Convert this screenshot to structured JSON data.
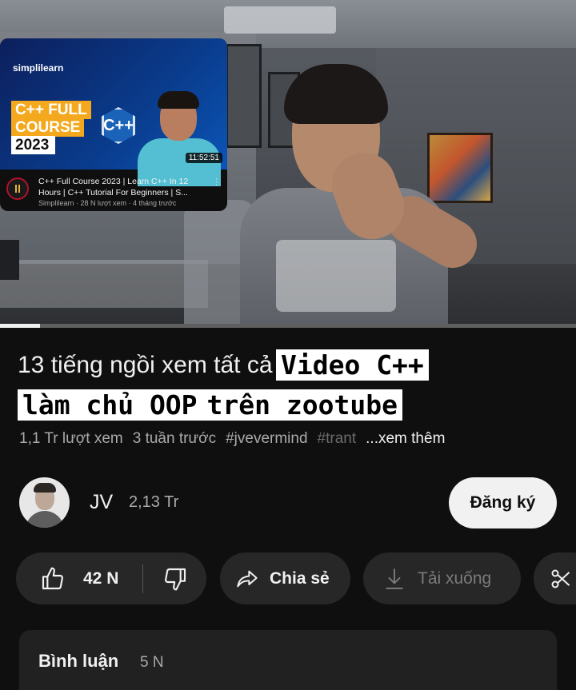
{
  "player": {
    "progress_fraction": 0.07,
    "embedded_card": {
      "brand": "simplilearn",
      "logo_text": "C++",
      "tags": [
        "C++ FULL",
        "COURSE",
        "2023"
      ],
      "duration": "11:52:51",
      "title": "C++ Full Course 2023 | Learn C++ In 12 Hours | C++ Tutorial For Beginners | S...",
      "meta": "Simplilearn · 28 N lượt xem · 4 tháng trước"
    }
  },
  "video": {
    "title_plain": "13 tiếng ngồi xem tất cả",
    "title_boxed_1": "Video C++",
    "title_boxed_2a": "làm chủ OOP",
    "title_boxed_2b": "trên zootube",
    "views": "1,1 Tr lượt xem",
    "uploaded": "3 tuần trước",
    "hashtag_1": "#jvevermind",
    "hashtag_2": "#trant",
    "more": "...xem thêm"
  },
  "channel": {
    "name": "JV",
    "subscribers": "2,13 Tr",
    "subscribe_label": "Đăng ký"
  },
  "actions": {
    "like_count": "42 N",
    "share_label": "Chia sẻ",
    "download_label": "Tải xuống"
  },
  "comments": {
    "title": "Bình luận",
    "count": "5 N"
  }
}
